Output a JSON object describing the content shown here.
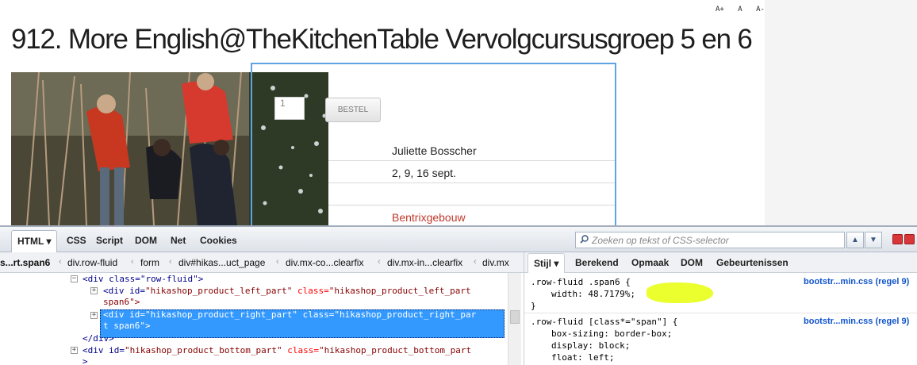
{
  "font_tools": {
    "increase": "A+",
    "normal": "A",
    "decrease": "A-"
  },
  "page": {
    "title": "912. More English@TheKitchenTable Vervolgcursusgroep 5 en 6",
    "quantity_value": "1",
    "order_button": "BESTEL",
    "info": {
      "teacher": "Juliette Bosscher",
      "dates": "2, 9, 16 sept.",
      "empty": "",
      "location": "Bentrixgebouw"
    }
  },
  "firebug": {
    "tabs": [
      "HTML",
      "CSS",
      "Script",
      "DOM",
      "Net",
      "Cookies"
    ],
    "search_placeholder": "Zoeken op tekst of CSS-selector",
    "breadcrumbs": [
      "s...rt.span6",
      "div.row-fluid",
      "form",
      "div#hikas...uct_page",
      "div.mx-co...clearfix",
      "div.mx-in...clearfix",
      "div.mx"
    ],
    "side_tabs": [
      "Stijl",
      "Berekend",
      "Opmaak",
      "DOM",
      "Gebeurtenissen"
    ],
    "html_lines": {
      "l1_tag": "<div class=\"row-fluid\">",
      "l2a": "<div id=",
      "l2_id": "\"hikashop_product_left_part\"",
      "l2_cls_attr": " class=",
      "l2_cls": "\"hikashop_product_left_part",
      "l3": "span6\">",
      "l4a": "<div id=",
      "l4_id": "\"hikashop_product_right_part\"",
      "l4_cls_attr": " class=",
      "l4_cls": "\"hikashop_product_right_par",
      "l5": "t span6\">",
      "l6": "</div>",
      "l7a": "<div id=",
      "l7_id": "\"hikashop_product_bottom_part\"",
      "l7_cls_attr": " class=",
      "l7_cls": "\"hikashop_product_bottom_part",
      "l8": ">"
    },
    "css_rules": {
      "r1_selector": ".row-fluid .span6 {",
      "r1_prop": "width",
      "r1_val": "48.7179%;",
      "r1_close": "}",
      "r1_source": "bootstr...min.css (regel 9)",
      "r2_selector": ".row-fluid [class*=\"span\"] {",
      "r2_p1": "box-sizing",
      "r2_v1": "border-box;",
      "r2_p2": "display",
      "r2_v2": "block;",
      "r2_p3": "float",
      "r2_v3": "left;",
      "r2_source": "bootstr...min.css (regel 9)"
    }
  }
}
